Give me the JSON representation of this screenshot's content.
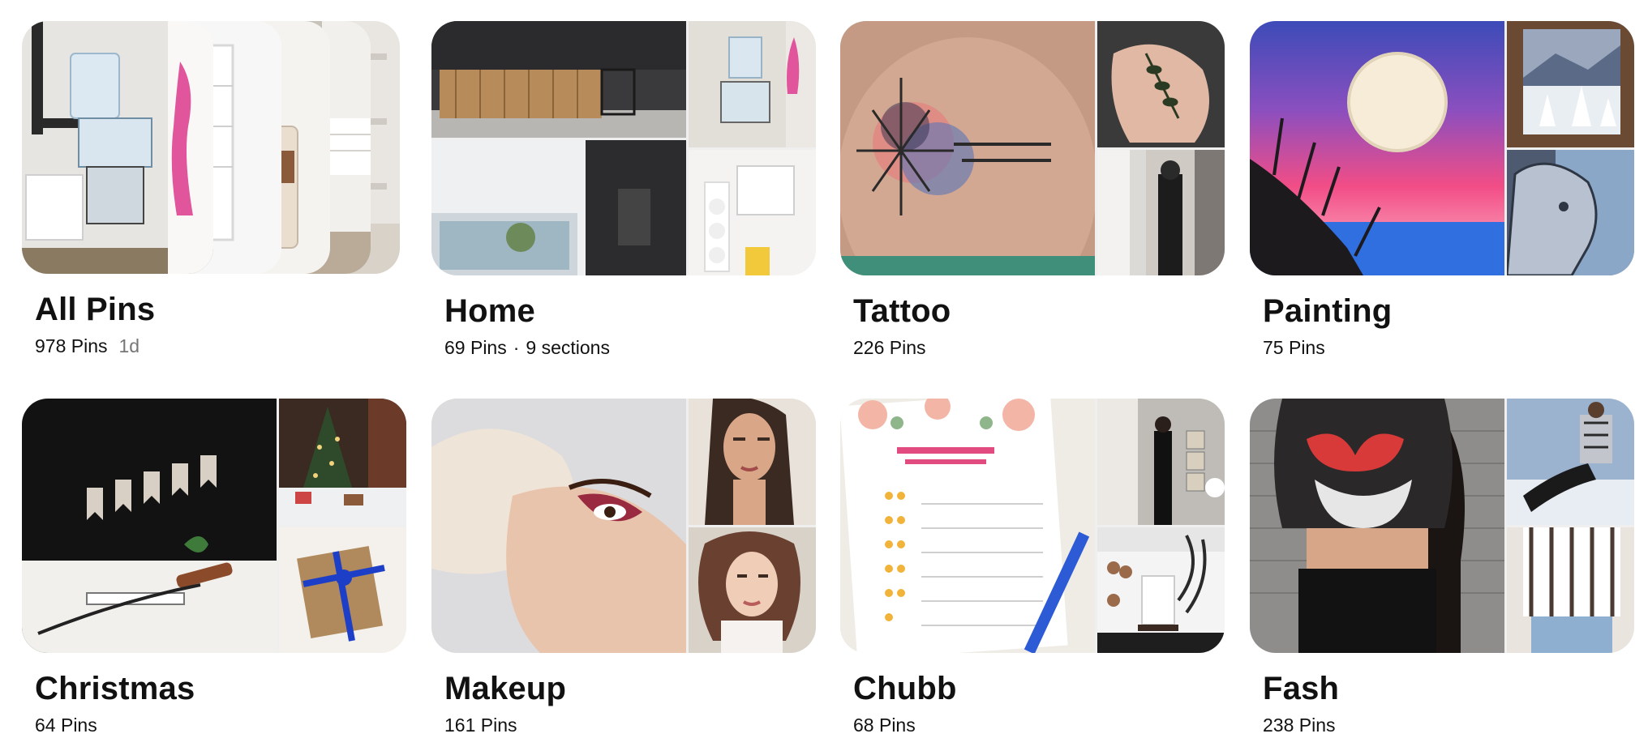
{
  "boards": [
    {
      "title": "All Pins",
      "pins": "978 Pins",
      "updated": "1d",
      "sections": ""
    },
    {
      "title": "Home",
      "pins": "69 Pins",
      "sections_dot": "·",
      "sections": "9 sections",
      "updated": ""
    },
    {
      "title": "Tattoo",
      "pins": "226 Pins",
      "updated": "",
      "sections": ""
    },
    {
      "title": "Painting",
      "pins": "75 Pins",
      "updated": "",
      "sections": ""
    },
    {
      "title": "Christmas",
      "pins": "64 Pins",
      "updated": "",
      "sections": ""
    },
    {
      "title": "Makeup",
      "pins": "161 Pins",
      "updated": "",
      "sections": ""
    },
    {
      "title": "Chubb",
      "pins": "68 Pins",
      "updated": "",
      "sections": ""
    },
    {
      "title": "Fash",
      "pins": "238 Pins",
      "updated": "",
      "sections": ""
    }
  ],
  "colors": {
    "text": "#111111",
    "muted": "#767676",
    "background": "#ffffff"
  }
}
